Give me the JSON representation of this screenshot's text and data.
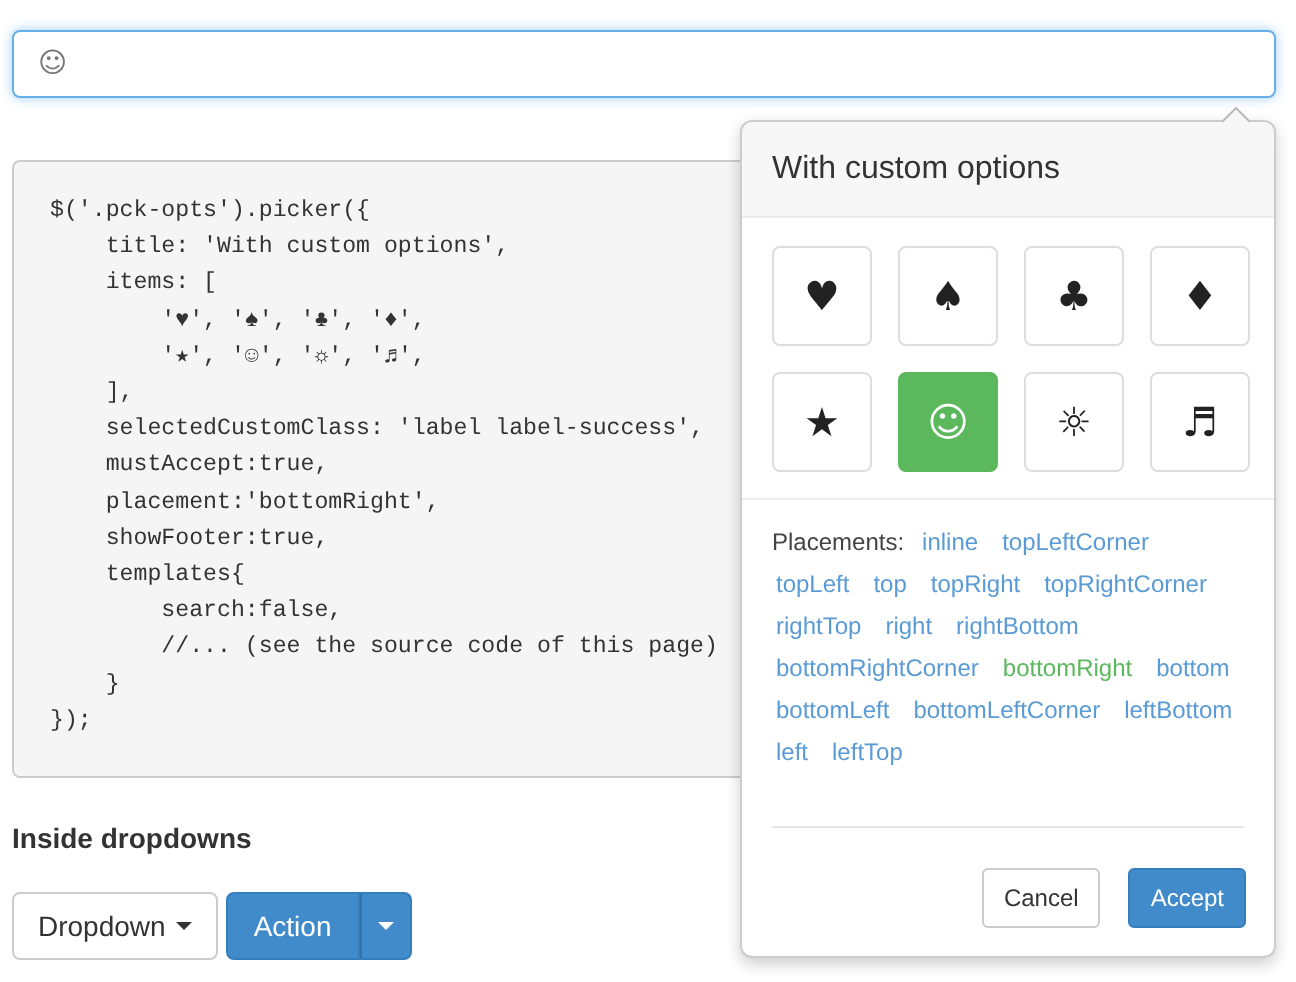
{
  "input": {
    "value": "☺",
    "focused": true
  },
  "code": [
    "$('.pck-opts').picker({",
    "    title: 'With custom options',",
    "    items: [",
    "        '♥', '♠', '♣', '♦',",
    "        '★', '☺', '☼', '♬',",
    "    ],",
    "    selectedCustomClass: 'label label-success',",
    "    mustAccept:true,",
    "    placement:'bottomRight',",
    "    showFooter:true,",
    "    templates{",
    "        search:false,",
    "        //... (see the source code of this page)",
    "    }",
    "});"
  ],
  "section_title": "Inside dropdowns",
  "buttons": [
    {
      "kind": "dropdown",
      "label": "Dropdown"
    },
    {
      "kind": "split",
      "label": "Action"
    }
  ],
  "popover": {
    "title": "With custom options",
    "items": [
      {
        "symbol": "♥",
        "selected": false
      },
      {
        "symbol": "♠",
        "selected": false
      },
      {
        "symbol": "♣",
        "selected": false
      },
      {
        "symbol": "♦",
        "selected": false
      },
      {
        "symbol": "★",
        "selected": false
      },
      {
        "symbol": "☺",
        "selected": true
      },
      {
        "symbol": "☼",
        "selected": false
      },
      {
        "symbol": "♬",
        "selected": false
      }
    ],
    "placements_label": "Placements:",
    "placements": [
      {
        "label": "inline",
        "selected": false
      },
      {
        "label": "topLeftCorner",
        "selected": false
      },
      {
        "label": "topLeft",
        "selected": false
      },
      {
        "label": "top",
        "selected": false
      },
      {
        "label": "topRight",
        "selected": false
      },
      {
        "label": "topRightCorner",
        "selected": false
      },
      {
        "label": "rightTop",
        "selected": false
      },
      {
        "label": "right",
        "selected": false
      },
      {
        "label": "rightBottom",
        "selected": false
      },
      {
        "label": "bottomRightCorner",
        "selected": false
      },
      {
        "label": "bottomRight",
        "selected": true
      },
      {
        "label": "bottom",
        "selected": false
      },
      {
        "label": "bottomLeft",
        "selected": false
      },
      {
        "label": "bottomLeftCorner",
        "selected": false
      },
      {
        "label": "leftBottom",
        "selected": false
      },
      {
        "label": "left",
        "selected": false
      },
      {
        "label": "leftTop",
        "selected": false
      }
    ],
    "footer_buttons": [
      {
        "kind": "default",
        "label": "Cancel"
      },
      {
        "kind": "primary",
        "label": "Accept"
      }
    ]
  }
}
